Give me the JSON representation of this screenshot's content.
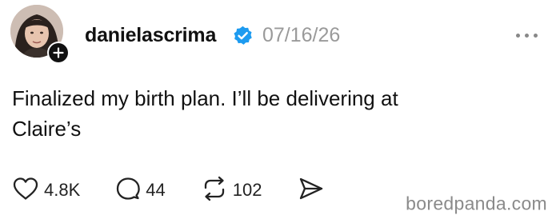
{
  "post": {
    "username": "danielascrima",
    "date": "07/16/26",
    "text_line1": "Finalized my birth plan. I’ll be delivering at",
    "text_line2": "Claire’s",
    "likes": "4.8K",
    "replies": "44",
    "reposts": "102"
  },
  "icons": {
    "verified": "verified-check-icon",
    "more": "more-dots-icon",
    "like": "heart-icon",
    "reply": "speech-bubble-icon",
    "repost": "repost-arrows-icon",
    "share": "send-icon",
    "follow": "plus-icon"
  },
  "colors": {
    "verified_blue": "#1d9bf0",
    "date_gray": "#9a9a9a",
    "text": "#111111"
  },
  "watermark": "boredpanda.com"
}
